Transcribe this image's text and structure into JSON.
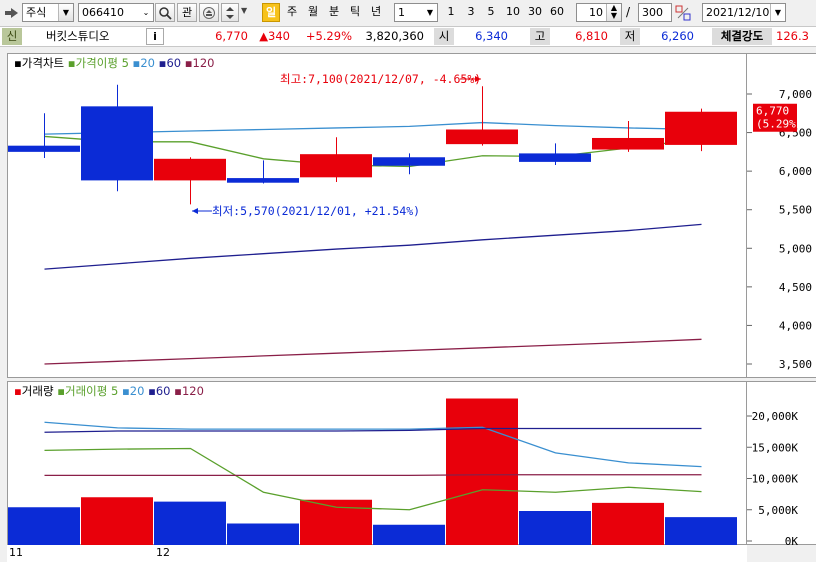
{
  "toolbar": {
    "market": "주식",
    "code": "066410",
    "fav_label": "관",
    "periods": [
      "일",
      "주",
      "월",
      "분",
      "틱",
      "년"
    ],
    "active_period": "일",
    "interval_value": "1",
    "quick_intervals": [
      "1",
      "3",
      "5",
      "10",
      "30",
      "60"
    ],
    "count_value": "10",
    "count_total": "300",
    "count_sep": "/",
    "date": "2021/12/10",
    "icons": [
      "screen-link-icon",
      "search-icon",
      "arrows-icon",
      "up-down-icon",
      "zoom-icon"
    ]
  },
  "quote": {
    "credit_label": "신",
    "name": "버킷스튜디오",
    "info_label": "i",
    "price": "6,770",
    "change": "▲340",
    "change_pct": "+5.29%",
    "volume": "3,820,360",
    "open_label": "시",
    "open": "6,340",
    "high_label": "고",
    "high": "6,810",
    "low_label": "저",
    "low": "6,260",
    "strength_label": "체결강도",
    "strength": "126.3"
  },
  "price_panel": {
    "legend": [
      "가격차트",
      "가격이평",
      "5",
      "20",
      "60",
      "120"
    ],
    "y_ticks": [
      "7,000",
      "6,500",
      "6,000",
      "5,500",
      "5,000",
      "4,500",
      "4,000",
      "3,500"
    ],
    "high_annotation": "최고:7,100(2021/12/07, -4.65%)",
    "low_annotation": "최저:5,570(2021/12/01, +21.54%)",
    "current_price": "6,770",
    "current_pct": "(5.29%)"
  },
  "volume_panel": {
    "legend": [
      "거래량",
      "거래이평",
      "5",
      "20",
      "60",
      "120"
    ],
    "y_ticks": [
      "20,000K",
      "15,000K",
      "10,000K",
      "5,000K",
      "0K"
    ]
  },
  "x_labels": [
    "11",
    "12"
  ],
  "chart_data": [
    {
      "type": "candlestick",
      "title": "",
      "ylim": [
        3300,
        7400
      ],
      "candles": [
        {
          "open": 6330,
          "close": 6250,
          "high": 6750,
          "low": 6170
        },
        {
          "open": 6840,
          "close": 5880,
          "high": 7120,
          "low": 5740
        },
        {
          "open": 5880,
          "close": 6160,
          "high": 6180,
          "low": 5570
        },
        {
          "open": 5910,
          "close": 5850,
          "high": 6140,
          "low": 5840
        },
        {
          "open": 5920,
          "close": 6220,
          "high": 6440,
          "low": 5860
        },
        {
          "open": 6180,
          "close": 6070,
          "high": 6230,
          "low": 5960
        },
        {
          "open": 6350,
          "close": 6540,
          "high": 7100,
          "low": 6330
        },
        {
          "open": 6230,
          "close": 6120,
          "high": 6360,
          "low": 6080
        },
        {
          "open": 6280,
          "close": 6430,
          "high": 6650,
          "low": 6250
        },
        {
          "open": 6340,
          "close": 6770,
          "high": 6810,
          "low": 6260
        }
      ],
      "series": [
        {
          "name": "5",
          "color": "#5aa02c",
          "values": [
            6450,
            6380,
            6380,
            6160,
            6080,
            6060,
            6200,
            6190,
            6300,
            6420
          ]
        },
        {
          "name": "20",
          "color": "#3a8fd0",
          "values": [
            6480,
            6500,
            6520,
            6540,
            6560,
            6580,
            6630,
            6590,
            6560,
            6540
          ]
        },
        {
          "name": "60",
          "color": "#1f1f8f",
          "values": [
            4730,
            4800,
            4870,
            4930,
            4990,
            5040,
            5110,
            5170,
            5230,
            5310
          ]
        },
        {
          "name": "120",
          "color": "#8a1f48",
          "values": [
            3500,
            3535,
            3570,
            3605,
            3640,
            3675,
            3710,
            3745,
            3780,
            3820
          ]
        }
      ]
    },
    {
      "type": "bar",
      "title": "",
      "ylim": [
        0,
        24000
      ],
      "unit": "K",
      "values": [
        5400,
        7000,
        6300,
        2800,
        6600,
        2600,
        22800,
        4800,
        6100,
        3820
      ],
      "colors": [
        "blue",
        "red",
        "blue",
        "blue",
        "red",
        "blue",
        "red",
        "blue",
        "red",
        "blue"
      ],
      "series": [
        {
          "name": "5",
          "color": "#5aa02c",
          "values": [
            14500,
            14700,
            14800,
            7800,
            5400,
            5000,
            8200,
            7800,
            8600,
            7900
          ]
        },
        {
          "name": "20",
          "color": "#3a8fd0",
          "values": [
            19000,
            18100,
            17900,
            17900,
            17900,
            17900,
            18200,
            14100,
            12500,
            11900
          ]
        },
        {
          "name": "60",
          "color": "#1f1f8f",
          "values": [
            17400,
            17600,
            17600,
            17600,
            17600,
            17700,
            18000,
            18000,
            18000,
            18000
          ]
        },
        {
          "name": "120",
          "color": "#8a1f48",
          "values": [
            10500,
            10500,
            10500,
            10500,
            10500,
            10500,
            10600,
            10600,
            10600,
            10600
          ]
        }
      ]
    }
  ]
}
